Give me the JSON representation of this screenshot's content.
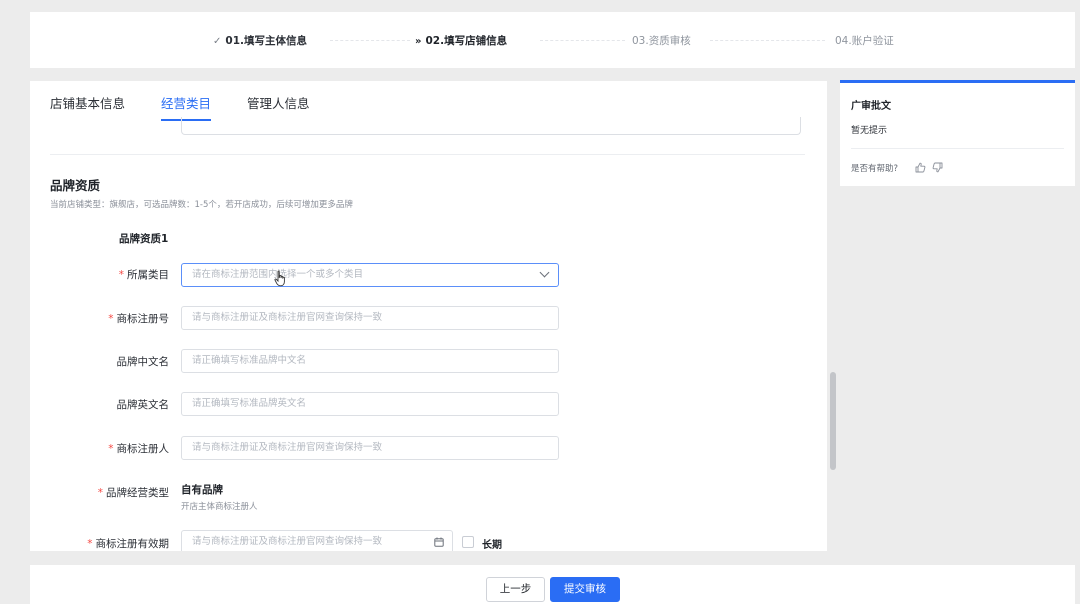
{
  "steps": [
    {
      "mark": "✓",
      "label": "01.填写主体信息",
      "state": "done"
    },
    {
      "mark": "»",
      "label": "02.填写店铺信息",
      "state": "active"
    },
    {
      "mark": "",
      "label": "03.资质审核",
      "state": "todo"
    },
    {
      "mark": "",
      "label": "04.账户验证",
      "state": "todo"
    }
  ],
  "tabs": [
    {
      "label": "店铺基本信息",
      "active": false
    },
    {
      "label": "经营类目",
      "active": true
    },
    {
      "label": "管理人信息",
      "active": false
    }
  ],
  "section": {
    "title": "品牌资质",
    "description": "当前店铺类型：旗舰店，可选品牌数：1-5个，若开店成功，后续可增加更多品牌",
    "subtitle": "品牌资质1"
  },
  "fields": {
    "category": {
      "label": "所属类目",
      "required": true,
      "placeholder": "请在商标注册范围内选择一个或多个类目"
    },
    "reg_no": {
      "label": "商标注册号",
      "required": true,
      "placeholder": "请与商标注册证及商标注册官网查询保持一致"
    },
    "cn_name": {
      "label": "品牌中文名",
      "required": false,
      "placeholder": "请正确填写标准品牌中文名"
    },
    "en_name": {
      "label": "品牌英文名",
      "required": false,
      "placeholder": "请正确填写标准品牌英文名"
    },
    "registrant": {
      "label": "商标注册人",
      "required": true,
      "placeholder": "请与商标注册证及商标注册官网查询保持一致"
    },
    "brand_type": {
      "label": "品牌经营类型",
      "required": true,
      "value": "自有品牌",
      "hint": "开店主体商标注册人"
    },
    "validity": {
      "label": "商标注册有效期",
      "required": true,
      "placeholder": "请与商标注册证及商标注册官网查询保持一致",
      "long_term_label": "长期"
    }
  },
  "side_panel": {
    "title": "广审批文",
    "text": "暂无提示",
    "help": "是否有帮助?"
  },
  "footer": {
    "prev_label": "上一步",
    "submit_label": "提交审核"
  },
  "colors": {
    "accent": "#2a6df4",
    "required": "#f54a45",
    "background": "#ececec"
  }
}
